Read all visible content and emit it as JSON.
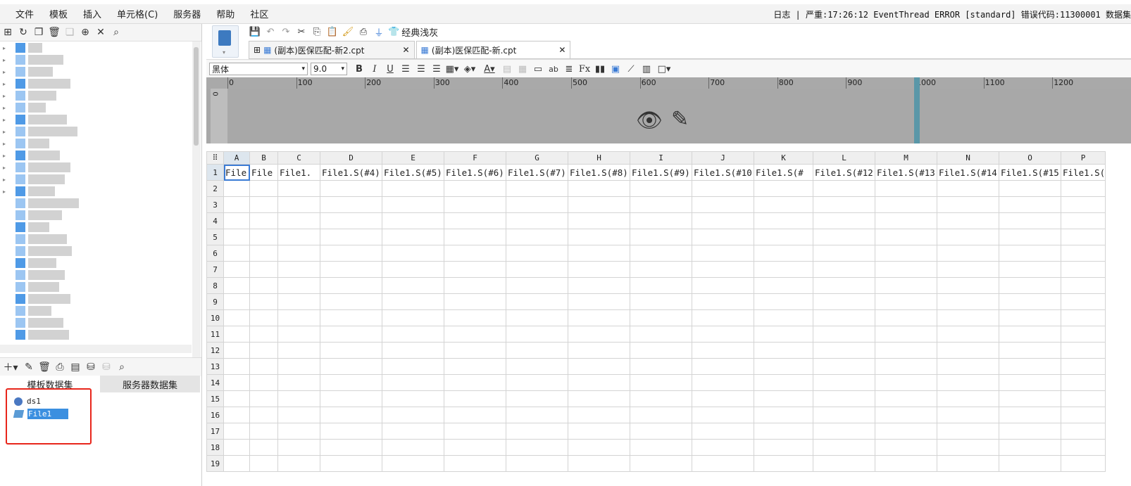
{
  "menubar": {
    "items": [
      "文件",
      "模板",
      "插入",
      "单元格(C)",
      "服务器",
      "帮助",
      "社区"
    ],
    "log_text": "日志 | 严重:17:26:12 EventThread ERROR [standard] 错误代码:11300001 数据集"
  },
  "left_toolbar": {
    "icons": [
      "new-folder-icon",
      "refresh-icon",
      "copy-icon",
      "delete-icon",
      "duplicate-icon",
      "locate-icon",
      "collapse-icon",
      "search-icon"
    ]
  },
  "datasource": {
    "tabs": [
      "模板数据集",
      "服务器数据集"
    ],
    "items": [
      {
        "label": "ds1",
        "icon": "database-icon"
      },
      {
        "label": "File1",
        "icon": "file-dataset-icon",
        "selected": true
      }
    ]
  },
  "designer": {
    "style_label": "经典浅灰",
    "tabs": [
      {
        "label": "(副本)医保匹配-新2.cpt",
        "active": false
      },
      {
        "label": "(副本)医保匹配-新.cpt",
        "active": true
      }
    ],
    "font_family": "黑体",
    "font_size": "9.0",
    "ruler_labels": [
      "0",
      "100",
      "200",
      "300",
      "400",
      "500",
      "600",
      "700",
      "800",
      "900",
      "1000",
      "1100",
      "1200"
    ]
  },
  "grid": {
    "columns": [
      "A",
      "B",
      "C",
      "D",
      "E",
      "F",
      "G",
      "H",
      "I",
      "J",
      "K",
      "L",
      "M",
      "N",
      "O",
      "P"
    ],
    "rows": [
      "1",
      "2",
      "3",
      "4",
      "5",
      "6",
      "7",
      "8",
      "9",
      "10",
      "11",
      "12",
      "13",
      "14",
      "15",
      "16",
      "17",
      "18",
      "19"
    ],
    "row1": [
      "File",
      "File",
      "File1.",
      "File1.S(#4)",
      "File1.S(#5)",
      "File1.S(#6)",
      "File1.S(#7)",
      "File1.S(#8)",
      "File1.S(#9)",
      "File1.S(#10",
      "File1.S(#",
      "File1.S(#12",
      "File1.S(#13",
      "File1.S(#14",
      "File1.S(#15",
      "File1.S("
    ]
  }
}
